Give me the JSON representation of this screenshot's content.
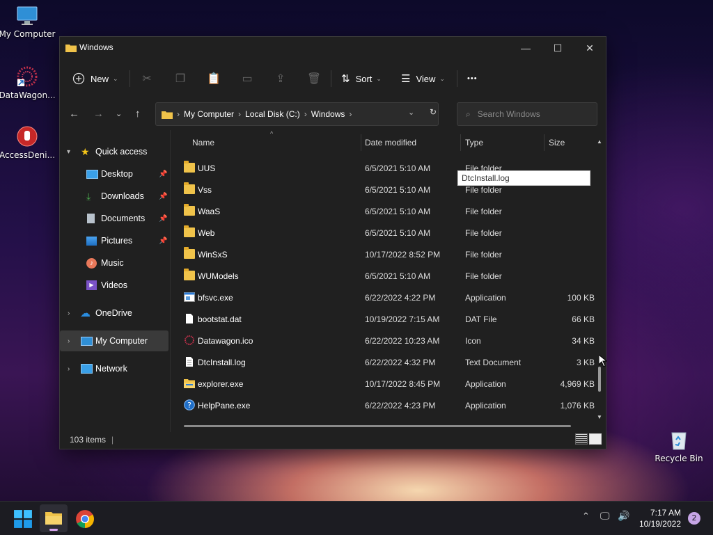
{
  "desktop": {
    "icons": [
      {
        "label": "My Computer"
      },
      {
        "label": "DataWagon..."
      },
      {
        "label": "AccessDeni..."
      },
      {
        "label": "Recycle Bin"
      }
    ]
  },
  "window": {
    "title": "Windows",
    "controls": {
      "minimize": "—",
      "maximize": "☐",
      "close": "✕"
    },
    "command_bar": {
      "new_label": "New",
      "sort_label": "Sort",
      "view_label": "View",
      "more_label": "•••"
    },
    "address": {
      "crumbs": [
        "My Computer",
        "Local Disk (C:)",
        "Windows"
      ],
      "search_placeholder": "Search Windows"
    },
    "sidebar": {
      "quick_access": "Quick access",
      "items": [
        "Desktop",
        "Downloads",
        "Documents",
        "Pictures",
        "Music",
        "Videos"
      ],
      "onedrive": "OneDrive",
      "my_computer": "My Computer",
      "network": "Network"
    },
    "columns": {
      "name": "Name",
      "date": "Date modified",
      "type": "Type",
      "size": "Size"
    },
    "files": [
      {
        "name": "UUS",
        "date": "6/5/2021 5:10 AM",
        "type": "File folder",
        "size": "",
        "icon": "folder-icon"
      },
      {
        "name": "Vss",
        "date": "6/5/2021 5:10 AM",
        "type": "File folder",
        "size": "",
        "icon": "folder-icon"
      },
      {
        "name": "WaaS",
        "date": "6/5/2021 5:10 AM",
        "type": "File folder",
        "size": "",
        "icon": "folder-icon"
      },
      {
        "name": "Web",
        "date": "6/5/2021 5:10 AM",
        "type": "File folder",
        "size": "",
        "icon": "folder-icon"
      },
      {
        "name": "WinSxS",
        "date": "10/17/2022 8:52 PM",
        "type": "File folder",
        "size": "",
        "icon": "folder-icon"
      },
      {
        "name": "WUModels",
        "date": "6/5/2021 5:10 AM",
        "type": "File folder",
        "size": "",
        "icon": "folder-icon"
      },
      {
        "name": "bfsvc.exe",
        "date": "6/22/2022 4:22 PM",
        "type": "Application",
        "size": "100 KB",
        "icon": "app-icon"
      },
      {
        "name": "bootstat.dat",
        "date": "10/19/2022 7:15 AM",
        "type": "DAT File",
        "size": "66 KB",
        "icon": "file-icon"
      },
      {
        "name": "Datawagon.ico",
        "date": "6/22/2022 10:23 AM",
        "type": "Icon",
        "size": "34 KB",
        "icon": "datawagon-icon"
      },
      {
        "name": "DtcInstall.log",
        "date": "6/22/2022 4:32 PM",
        "type": "Text Document",
        "size": "3 KB",
        "icon": "text-file-icon"
      },
      {
        "name": "explorer.exe",
        "date": "10/17/2022 8:45 PM",
        "type": "Application",
        "size": "4,969 KB",
        "icon": "explorer-icon"
      },
      {
        "name": "HelpPane.exe",
        "date": "6/22/2022 4:23 PM",
        "type": "Application",
        "size": "1,076 KB",
        "icon": "help-icon"
      }
    ],
    "tooltip": "DtcInstall.log",
    "status": "103 items"
  },
  "taskbar": {
    "time": "7:17 AM",
    "date": "10/19/2022",
    "notification_count": "2"
  }
}
